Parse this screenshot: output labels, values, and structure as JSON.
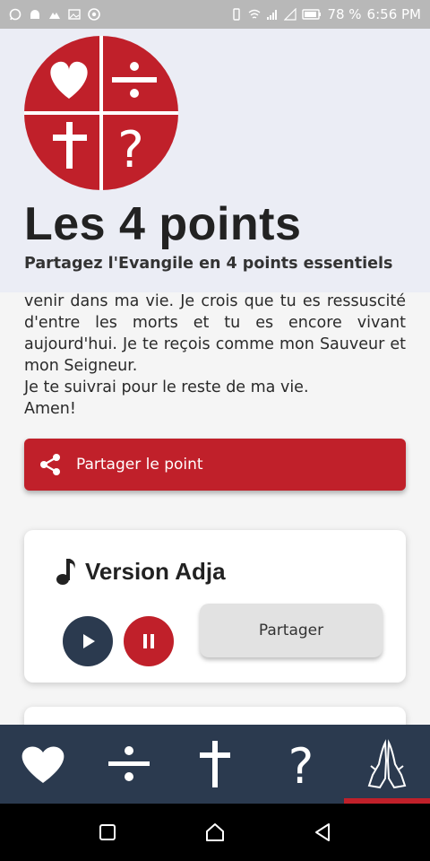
{
  "status_bar": {
    "battery": "78 %",
    "time": "6:56 PM",
    "icons": [
      "whatsapp-icon",
      "android-icon",
      "cloud-icon",
      "image-icon",
      "chrome-icon",
      "vibrate-icon",
      "wifi-icon",
      "signal-icon",
      "signal-empty-icon",
      "battery-icon"
    ]
  },
  "header": {
    "title": "Les 4 points",
    "subtitle": "Partagez l'Evangile en 4 points essentiels",
    "logo_color": "#c0202a"
  },
  "prayer": {
    "lines": [
      "venir dans ma vie. Je crois que tu es ressuscité d'entre les morts et tu es encore vivant aujourd'hui. Je te reçois comme mon Sauveur et mon Seigneur.",
      "Je te suivrai pour le reste de ma vie.",
      "Amen!"
    ]
  },
  "share_point_button": {
    "label": "Partager le point",
    "icon": "share-icon"
  },
  "audio_card": {
    "title": "Version Adja",
    "icon": "music-note-icon",
    "share_label": "Partager"
  },
  "bottom_nav": {
    "items": [
      {
        "icon": "heart-icon",
        "active": false
      },
      {
        "icon": "divide-icon",
        "active": false
      },
      {
        "icon": "cross-icon",
        "active": false
      },
      {
        "icon": "question-icon",
        "active": false
      },
      {
        "icon": "praying-hands-icon",
        "active": true
      }
    ],
    "background": "#2b3a4f",
    "accent": "#c0202a"
  },
  "system_nav": [
    "recents-button",
    "home-button",
    "back-button"
  ]
}
